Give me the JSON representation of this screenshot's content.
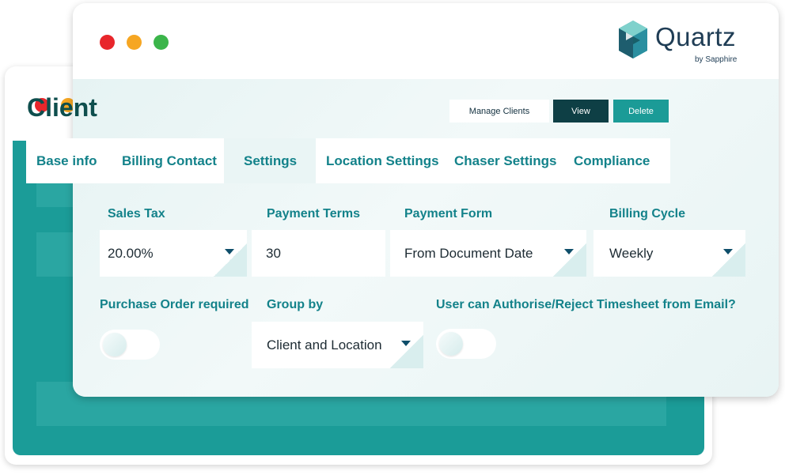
{
  "window": {
    "controls": [
      "close",
      "minimize",
      "maximize"
    ],
    "colors": {
      "close": "#e8262b",
      "minimize": "#f6a622",
      "maximize": "#3bb54a"
    }
  },
  "brand": {
    "name": "Quartz",
    "sub": "by Sapphire",
    "logo_icon": "hexagon-cube-icon"
  },
  "header": {
    "title": "Client",
    "buttons": {
      "manage": "Manage Clients",
      "view": "View",
      "delete": "Delete"
    }
  },
  "tabs": [
    {
      "label": "Base info"
    },
    {
      "label": "Billing Contact"
    },
    {
      "label": "Settings",
      "active": true
    },
    {
      "label": "Location Settings"
    },
    {
      "label": "Chaser Settings"
    },
    {
      "label": "Compliance"
    }
  ],
  "form": {
    "sales_tax": {
      "label": "Sales Tax",
      "value": "20.00%"
    },
    "payment_terms": {
      "label": "Payment Terms",
      "value": "30"
    },
    "payment_form": {
      "label": "Payment Form",
      "value": "From Document Date"
    },
    "billing_cycle": {
      "label": "Billing Cycle",
      "value": "Weekly"
    },
    "purchase_order": {
      "label": "Purchase Order required",
      "enabled": false
    },
    "group_by": {
      "label": "Group by",
      "value": "Client and Location"
    },
    "timesheet_email": {
      "label": "User can Authorise/Reject Timesheet from Email?",
      "enabled": false
    }
  },
  "colors": {
    "accent": "#13828a",
    "dark_teal": "#0e3f45",
    "teal": "#1b9b97"
  }
}
